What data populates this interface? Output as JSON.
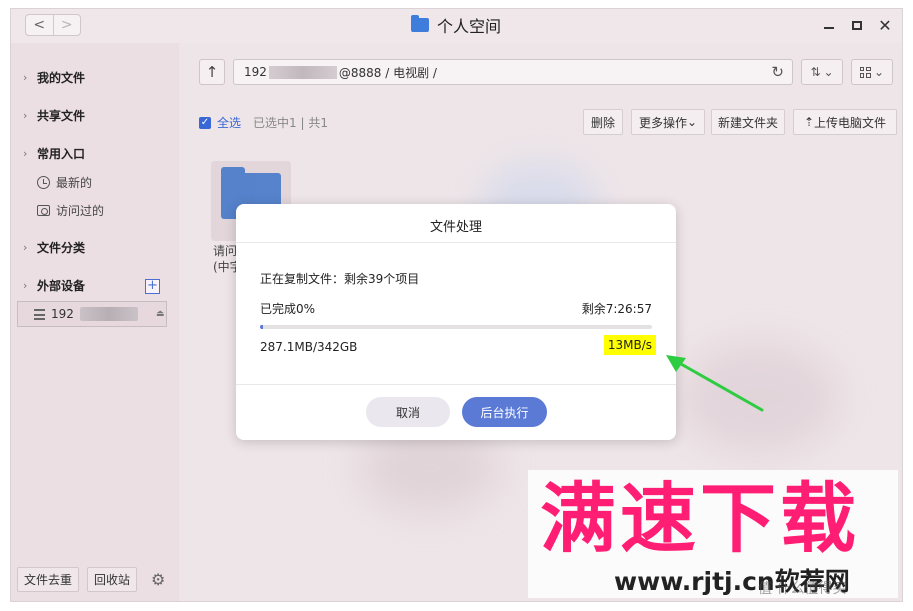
{
  "window": {
    "title": "个人空间",
    "nav_back": "<",
    "nav_forward": ">"
  },
  "sidebar": {
    "my_files": "我的文件",
    "shared_files": "共享文件",
    "common": "常用入口",
    "recent": "最新的",
    "visited": "访问过的",
    "categories": "文件分类",
    "external": "外部设备",
    "add": "+",
    "device_prefix": "192",
    "dedupe": "文件去重",
    "recycle": "回收站"
  },
  "toolbar": {
    "path_prefix": "192",
    "path_suffix": "@8888 / 电视剧 /",
    "select_all": "全选",
    "selection_status": "已选中1 | 共1",
    "delete": "删除",
    "more": "更多操作",
    "new_folder": "新建文件夹",
    "upload": "上传电脑文件"
  },
  "files": [
    {
      "name": "请问\n(中字"
    }
  ],
  "dialog": {
    "title": "文件处理",
    "message": "正在复制文件：剩余39个项目",
    "completed": "已完成0%",
    "remaining_time": "剩余7:26:57",
    "progress": 0.0084,
    "size": "287.1MB/342GB",
    "speed": "13MB/s",
    "cancel": "取消",
    "background": "后台执行"
  },
  "overlay": {
    "headline": "满速下载",
    "site": "www.rjtj.cn软荐网",
    "watermark": "值 什么值得买"
  },
  "colors": {
    "accent": "#5a7ad6",
    "highlight": "#ffff00",
    "headline": "#ff1e73",
    "arrow": "#2ecc40"
  }
}
